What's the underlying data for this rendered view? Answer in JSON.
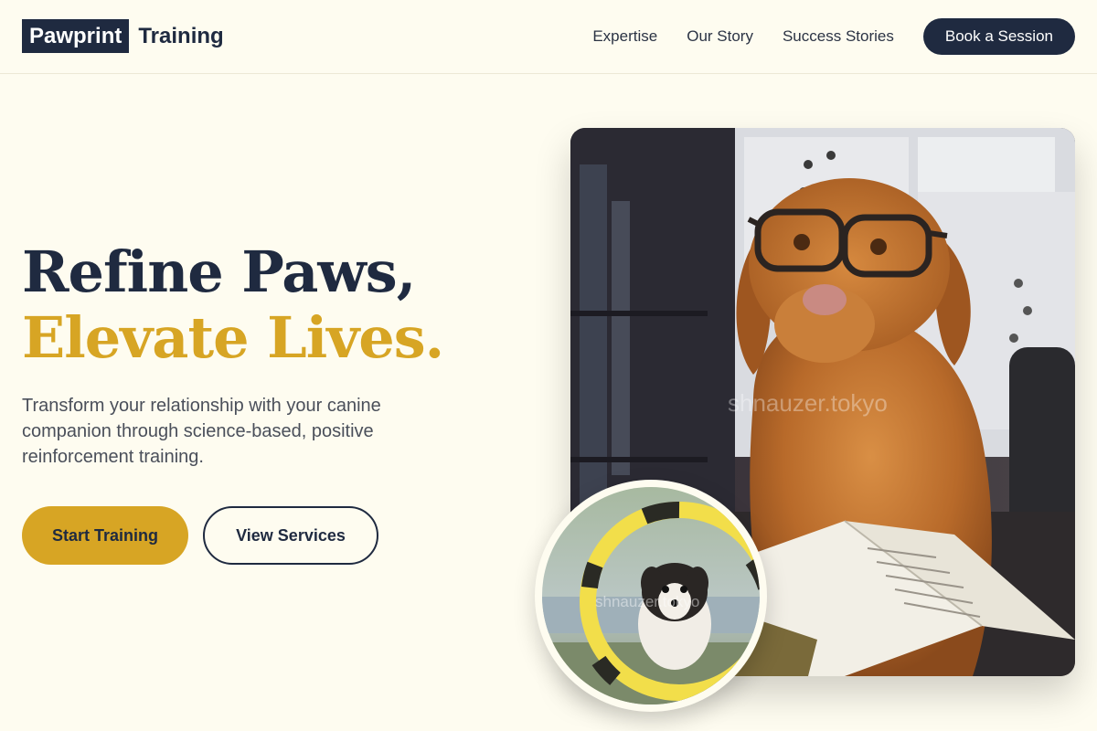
{
  "header": {
    "logo_boxed": "Pawprint",
    "logo_text": "Training",
    "nav": [
      "Expertise",
      "Our Story",
      "Success Stories"
    ],
    "cta": "Book a Session"
  },
  "hero": {
    "headline_line1": "Refine Paws,",
    "headline_line2": "Elevate Lives.",
    "subtext": "Transform your relationship with your canine companion through science-based, positive reinforcement training.",
    "primary_button": "Start Training",
    "secondary_button": "View Services"
  },
  "images": {
    "main_watermark": "shnauzer.tokyo",
    "circle_watermark": "shnauzer.tokyo",
    "main_icon": "dog-with-glasses-photo",
    "circle_icon": "dog-jumping-through-hoop-photo"
  },
  "colors": {
    "navy": "#1f2a40",
    "gold": "#d7a524",
    "background": "#fefcf0"
  }
}
